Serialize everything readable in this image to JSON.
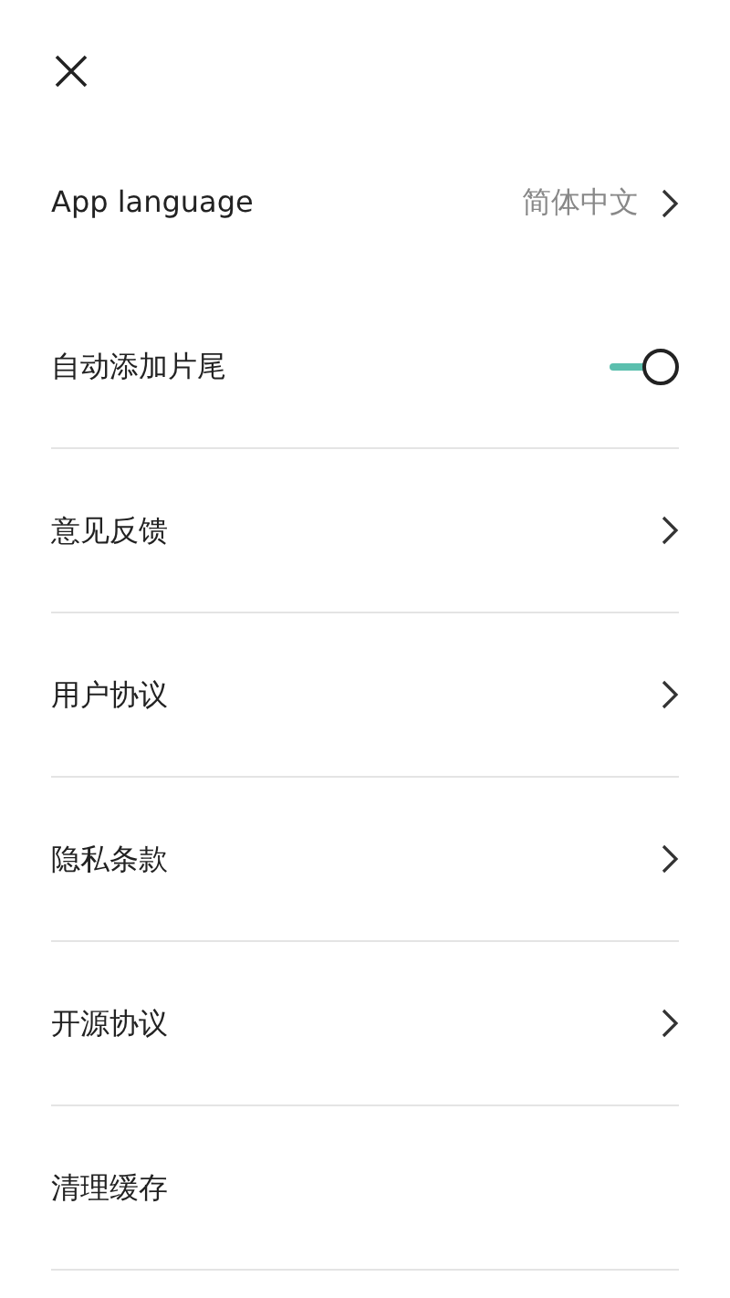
{
  "rows": [
    {
      "kind": "value",
      "label": "App language",
      "value": "简体中文"
    },
    {
      "kind": "toggle",
      "label": "自动添加片尾",
      "on": true
    },
    {
      "kind": "link",
      "label": "意见反馈"
    },
    {
      "kind": "link",
      "label": "用户协议"
    },
    {
      "kind": "link",
      "label": "隐私条款"
    },
    {
      "kind": "link",
      "label": "开源协议"
    },
    {
      "kind": "plain",
      "label": "清理缓存"
    }
  ]
}
